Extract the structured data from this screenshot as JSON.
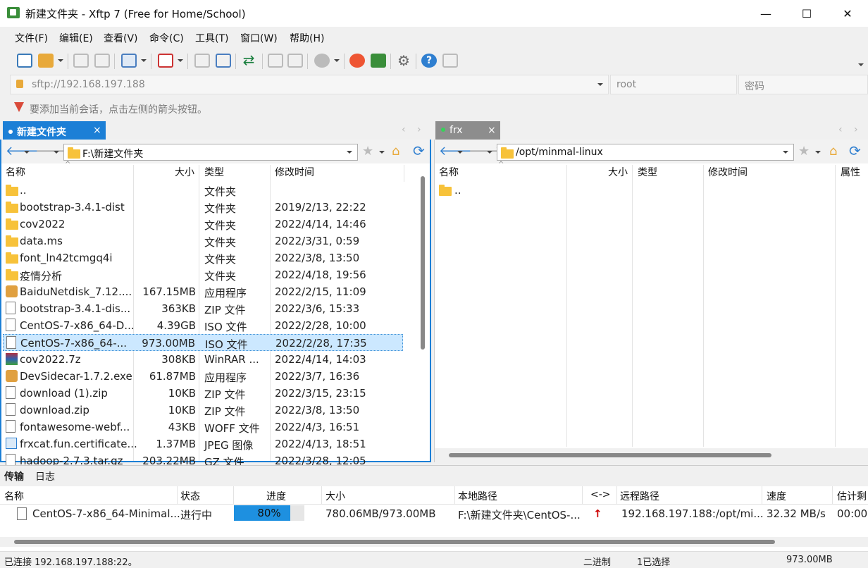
{
  "window": {
    "title": "新建文件夹 - Xftp 7 (Free for Home/School)",
    "min_glyph": "—",
    "max_glyph": "☐",
    "close_glyph": "✕"
  },
  "menu": [
    "文件(F)",
    "编辑(E)",
    "查看(V)",
    "命令(C)",
    "工具(T)",
    "窗口(W)",
    "帮助(H)"
  ],
  "address": {
    "host_placeholder": "sftp://192.168.197.188",
    "user": "root",
    "password_placeholder": "密码",
    "hint": "要添加当前会话，点击左侧的箭头按钮。"
  },
  "left_pane": {
    "tab_label": "新建文件夹",
    "tab_close": "×",
    "path": "F:\\新建文件夹",
    "columns": [
      "名称",
      "大小",
      "类型",
      "修改时间"
    ],
    "rows": [
      {
        "name": "..",
        "size": "",
        "type": "文件夹",
        "date": "",
        "icon": "folder-icon"
      },
      {
        "name": "bootstrap-3.4.1-dist",
        "size": "",
        "type": "文件夹",
        "date": "2019/2/13, 22:22",
        "icon": "folder-icon"
      },
      {
        "name": "cov2022",
        "size": "",
        "type": "文件夹",
        "date": "2022/4/14, 14:46",
        "icon": "folder-icon"
      },
      {
        "name": "data.ms",
        "size": "",
        "type": "文件夹",
        "date": "2022/3/31, 0:59",
        "icon": "folder-icon"
      },
      {
        "name": "font_ln42tcmgq4i",
        "size": "",
        "type": "文件夹",
        "date": "2022/3/8, 13:50",
        "icon": "folder-icon"
      },
      {
        "name": "疫情分析",
        "size": "",
        "type": "文件夹",
        "date": "2022/4/18, 19:56",
        "icon": "folder-icon"
      },
      {
        "name": "BaiduNetdisk_7.12....",
        "size": "167.15MB",
        "type": "应用程序",
        "date": "2022/2/15, 11:09",
        "icon": "app-icon"
      },
      {
        "name": "bootstrap-3.4.1-dis...",
        "size": "363KB",
        "type": "ZIP 文件",
        "date": "2022/3/6, 15:33",
        "icon": "file-icon"
      },
      {
        "name": "CentOS-7-x86_64-D...",
        "size": "4.39GB",
        "type": "ISO 文件",
        "date": "2022/2/28, 10:00",
        "icon": "file-icon"
      },
      {
        "name": "CentOS-7-x86_64-...",
        "size": "973.00MB",
        "type": "ISO 文件",
        "date": "2022/2/28, 17:35",
        "icon": "file-icon"
      },
      {
        "name": "cov2022.7z",
        "size": "308KB",
        "type": "WinRAR ...",
        "date": "2022/4/14, 14:03",
        "icon": "winrar-icon"
      },
      {
        "name": "DevSidecar-1.7.2.exe",
        "size": "61.87MB",
        "type": "应用程序",
        "date": "2022/3/7, 16:36",
        "icon": "app-icon"
      },
      {
        "name": "download (1).zip",
        "size": "10KB",
        "type": "ZIP 文件",
        "date": "2022/3/15, 23:15",
        "icon": "file-icon"
      },
      {
        "name": "download.zip",
        "size": "10KB",
        "type": "ZIP 文件",
        "date": "2022/3/8, 13:50",
        "icon": "file-icon"
      },
      {
        "name": "fontawesome-webf...",
        "size": "43KB",
        "type": "WOFF 文件",
        "date": "2022/4/3, 16:51",
        "icon": "file-icon"
      },
      {
        "name": "frxcat.fun.certificate...",
        "size": "1.37MB",
        "type": "JPEG 图像",
        "date": "2022/4/13, 18:51",
        "icon": "image-icon"
      },
      {
        "name": "hadoop-2.7.3.tar.gz",
        "size": "203.22MB",
        "type": "GZ 文件",
        "date": "2022/3/28, 12:05",
        "icon": "file-icon"
      }
    ],
    "selected_index": 9
  },
  "right_pane": {
    "tab_label": "frx",
    "tab_close": "×",
    "path": "/opt/minmal-linux",
    "columns": [
      "名称",
      "大小",
      "类型",
      "修改时间",
      "属性"
    ],
    "rows": [
      {
        "name": "..",
        "icon": "folder-icon"
      }
    ]
  },
  "transfer": {
    "tabs": [
      "传输",
      "日志"
    ],
    "columns": [
      "名称",
      "状态",
      "进度",
      "大小",
      "本地路径",
      "<->",
      "远程路径",
      "速度",
      "估计剩"
    ],
    "rows": [
      {
        "name": "CentOS-7-x86_64-Minimal...",
        "status": "进行中",
        "progress_label": "80%",
        "progress": 0.8,
        "size": "780.06MB/973.00MB",
        "local": "F:\\新建文件夹\\CentOS-...",
        "direction": "↑",
        "remote": "192.168.197.188:/opt/mi...",
        "speed": "32.32 MB/s",
        "eta": "00:00:"
      }
    ]
  },
  "status": {
    "connection": "已连接 192.168.197.188:22。",
    "mode": "二进制",
    "selection": "1已选择",
    "size": "973.00MB"
  },
  "colors": {
    "accent": "#1c7fd6",
    "progress": "#1e90e0",
    "folder": "#f7c23a",
    "selected_row": "#cce8ff"
  }
}
